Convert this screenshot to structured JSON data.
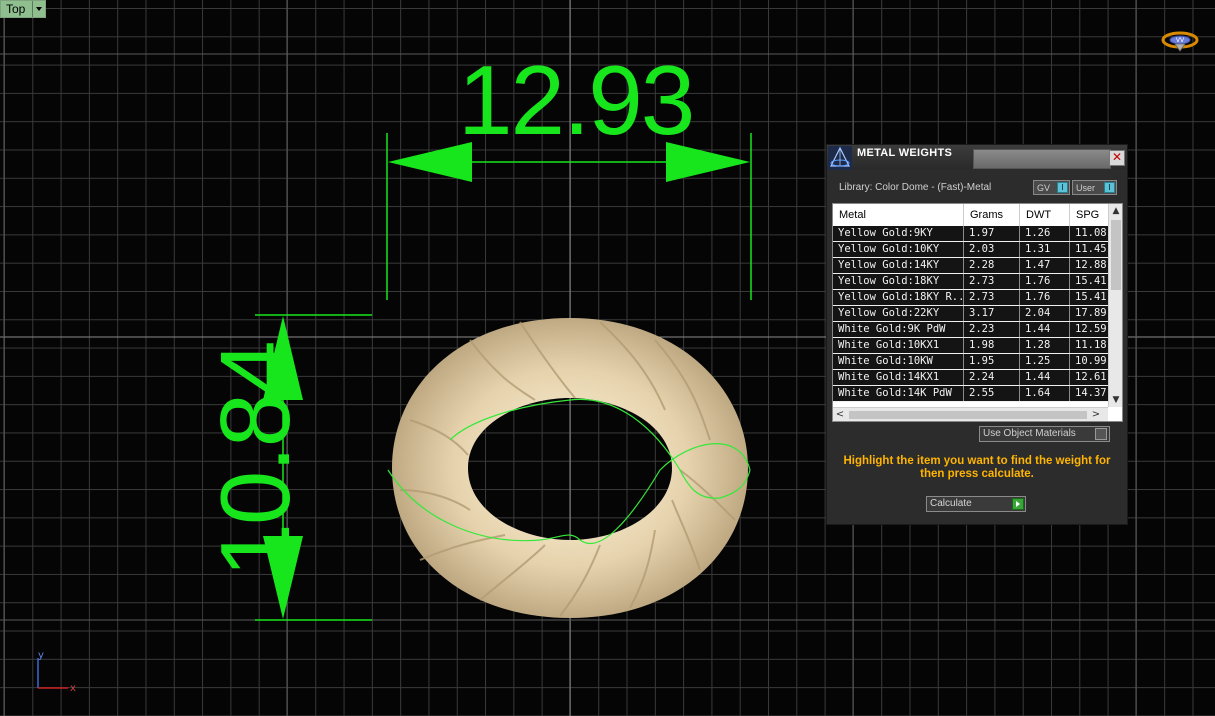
{
  "viewport": {
    "view_name": "Top",
    "grid_color": "#3a3a3a",
    "major_grid_color": "#8a8a8a",
    "dimension_color": "#17e61d",
    "model_color": "#e6d3ad"
  },
  "dimensions": {
    "width": "12.93",
    "height": "10.84"
  },
  "axes": {
    "x_label": "x",
    "y_label": "y"
  },
  "panel": {
    "title": "METAL WEIGHTS",
    "close_symbol": "✕",
    "library_label": "Library: Color Dome - (Fast)-Metal",
    "gv_label": "GV",
    "user_label": "User",
    "indicator_symbol": "I",
    "columns": [
      "Metal",
      "Grams",
      "DWT",
      "SPG"
    ],
    "rows": [
      {
        "metal": "Yellow Gold:9KY",
        "grams": "1.97",
        "dwt": "1.26",
        "spg": "11.08"
      },
      {
        "metal": "Yellow Gold:10KY",
        "grams": "2.03",
        "dwt": "1.31",
        "spg": "11.45"
      },
      {
        "metal": "Yellow Gold:14KY",
        "grams": "2.28",
        "dwt": "1.47",
        "spg": "12.88"
      },
      {
        "metal": "Yellow Gold:18KY",
        "grams": "2.73",
        "dwt": "1.76",
        "spg": "15.41"
      },
      {
        "metal": "Yellow Gold:18KY R...",
        "grams": "2.73",
        "dwt": "1.76",
        "spg": "15.41"
      },
      {
        "metal": "Yellow Gold:22KY",
        "grams": "3.17",
        "dwt": "2.04",
        "spg": "17.89"
      },
      {
        "metal": "White Gold:9K PdW",
        "grams": "2.23",
        "dwt": "1.44",
        "spg": "12.59"
      },
      {
        "metal": "White Gold:10KX1",
        "grams": "1.98",
        "dwt": "1.28",
        "spg": "11.18"
      },
      {
        "metal": "White Gold:10KW",
        "grams": "1.95",
        "dwt": "1.25",
        "spg": "10.99"
      },
      {
        "metal": "White Gold:14KX1",
        "grams": "2.24",
        "dwt": "1.44",
        "spg": "12.61"
      },
      {
        "metal": "White Gold:14K PdW",
        "grams": "2.55",
        "dwt": "1.64",
        "spg": "14.37"
      }
    ],
    "use_object_materials_label": "Use Object Materials",
    "instruction": "Highlight the item you want to find the weight for then press calculate.",
    "calculate_label": "Calculate",
    "scroll_up": "▲",
    "scroll_down": "▼",
    "scroll_left": "<",
    "scroll_right": ">"
  }
}
